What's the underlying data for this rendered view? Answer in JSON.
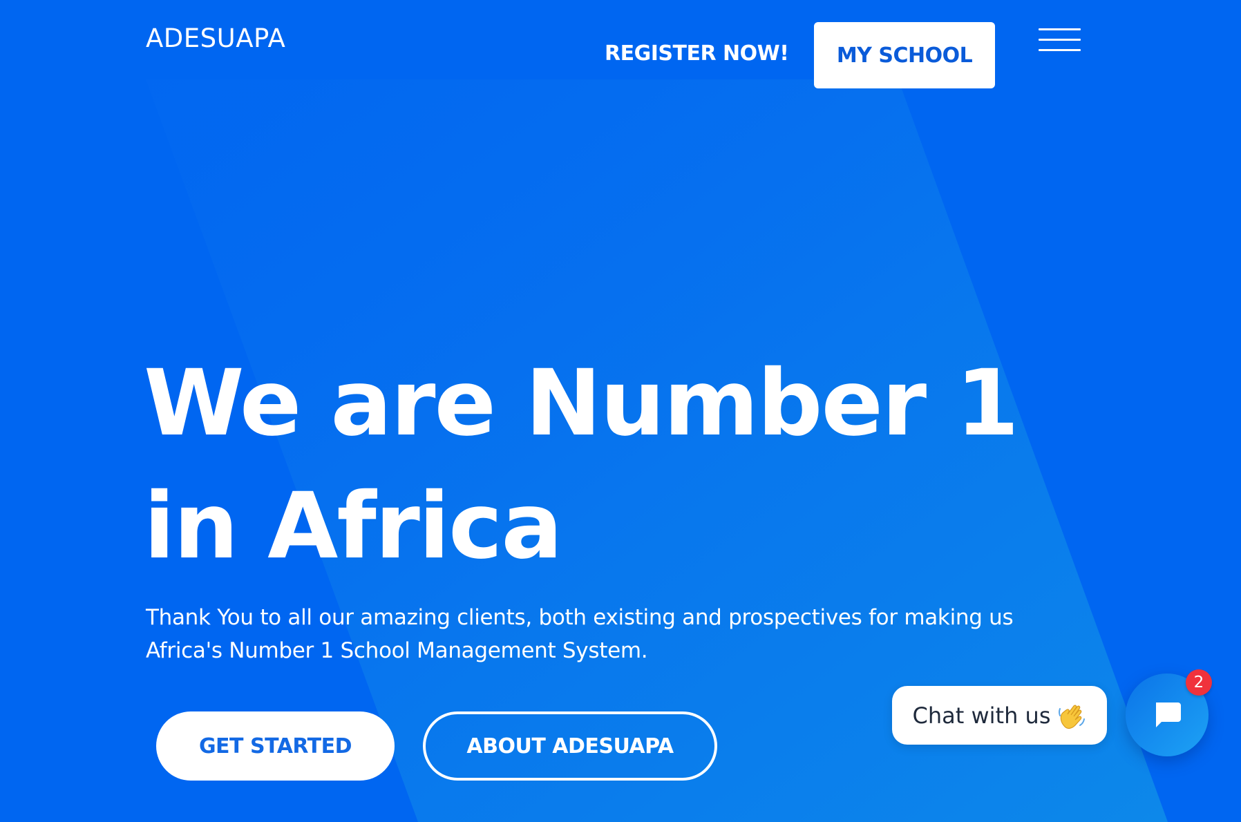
{
  "header": {
    "logo": "ADESUAPA",
    "register_label": "REGISTER NOW!",
    "my_school_label": "MY SCHOOL",
    "menu_icon": "hamburger-menu-icon"
  },
  "hero": {
    "title_line1": "We are Number 1",
    "title_line2": "in Africa",
    "subtitle_line1": "Thank You to all our amazing clients, both existing and prospectives for making us",
    "subtitle_line2": "Africa's Number 1 School Management System.",
    "get_started_label": "GET STARTED",
    "about_label": "ABOUT ADESUAPA"
  },
  "chat": {
    "bubble_text": "Chat with us",
    "bubble_icon": "waving-hand-icon",
    "launcher_icon": "chat-icon",
    "badge_count": "2"
  },
  "colors": {
    "background": "#0066F1",
    "panel_highlight": "#0B82EC",
    "button_text_blue": "#1369E4",
    "badge_red": "#F0323C",
    "white": "#FFFFFF"
  }
}
